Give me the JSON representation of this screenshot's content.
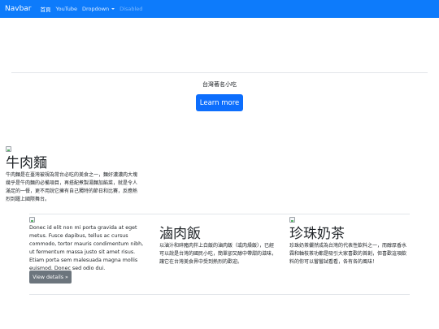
{
  "navbar": {
    "brand": "Navbar",
    "links": [
      {
        "label": "首頁"
      },
      {
        "label": "YouTube"
      },
      {
        "label": "Dropdown"
      },
      {
        "label": "Disabled"
      }
    ]
  },
  "hero": {
    "title": "台灣著名小吃",
    "button_label": "Learn more"
  },
  "feature": {
    "title": "牛肉麵",
    "text": "牛肉麵是在臺灣被視為常台必吃的美食之一，麵好濃濃肉大塊幾乎是牛肉麵的必備項目，再搭配煮製湯麵加餡菜，就是令人滿足的一餐，更不用說它擁有自己獨特的節日和比賽，反應熱烈到躍上國際舞台。"
  },
  "cards": [
    {
      "title": "",
      "text": "Donec id elit non mi porta gravida at eget metus. Fusce dapibus, tellus ac cursus commodo, tortor mauris condimentum nibh, ut fermentum massa justo sit amet risus. Etiam porta sem malesuada magna mollis euismod. Donec sed odio dui.",
      "button_label": "View details »"
    },
    {
      "title": "滷肉飯",
      "text": "以滷汁和碎豬肉拌上白飯的滷肉飯（或肉燥飯），已經可以說是台灣的國民小吃，簡單卻又醇中帶甜的滋味，讓它在台灣美食界中受到熱烈的歡迎。"
    },
    {
      "title": "珍珠奶茶",
      "text": "珍珠奶茶儼然成為台灣的代表性飲料之一，而醇厚香水霖和軸枝茶功都是吸引大家喜歡的首創，但喜歡這項飲料的你可以嘗嘗試看看，各有各的風味！"
    }
  ]
}
